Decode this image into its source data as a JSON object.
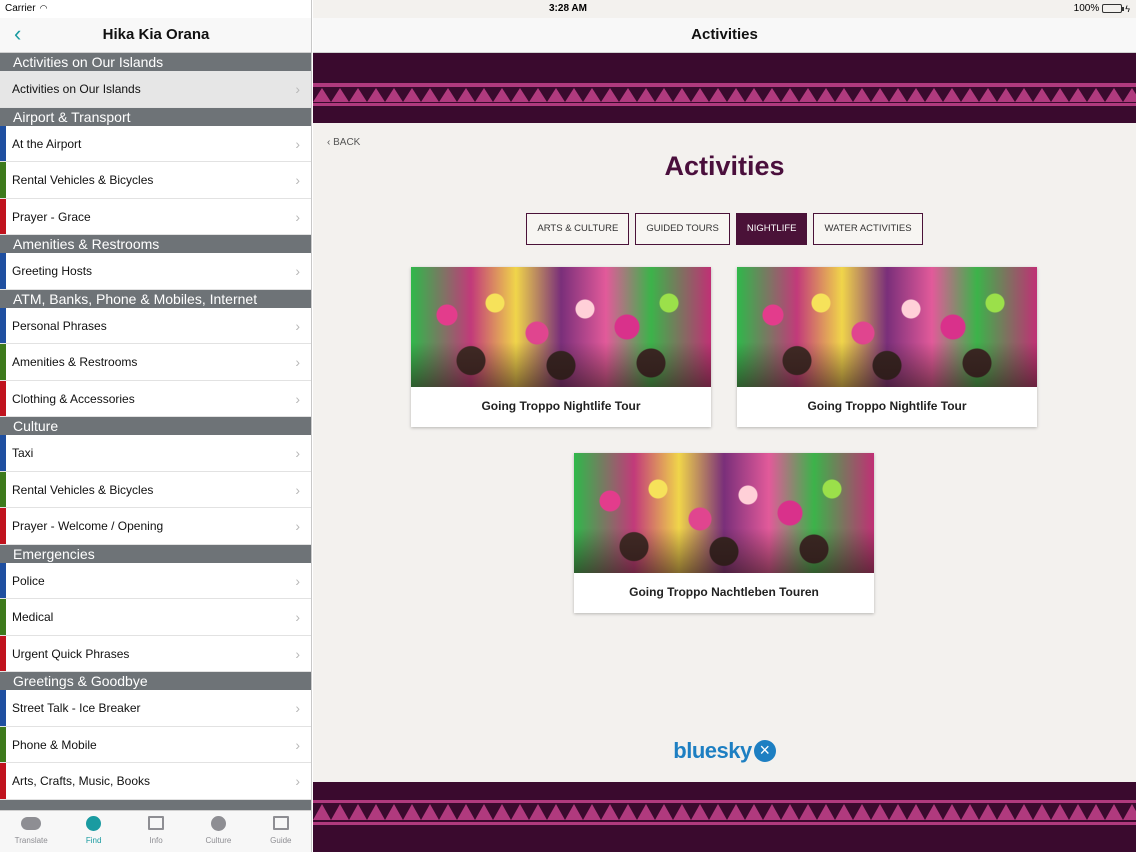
{
  "status": {
    "carrier": "Carrier",
    "time": "3:28 AM",
    "battery": "100%"
  },
  "left": {
    "title": "Hika Kia Orana",
    "sections": [
      {
        "header": "Activities on Our Islands",
        "items": [
          {
            "label": "Activities on Our Islands",
            "color": "",
            "selected": true
          }
        ]
      },
      {
        "header": "Airport & Transport",
        "items": [
          {
            "label": "At the Airport",
            "color": "#1f4fa0"
          },
          {
            "label": "Rental Vehicles & Bicycles",
            "color": "#3d7a1c"
          },
          {
            "label": "Prayer - Grace",
            "color": "#c0131e"
          }
        ]
      },
      {
        "header": "Amenities & Restrooms",
        "items": [
          {
            "label": "Greeting Hosts",
            "color": "#1f4fa0"
          }
        ]
      },
      {
        "header": "ATM, Banks, Phone & Mobiles, Internet",
        "items": [
          {
            "label": "Personal Phrases",
            "color": "#1f4fa0"
          },
          {
            "label": "Amenities & Restrooms",
            "color": "#3d7a1c"
          },
          {
            "label": "Clothing & Accessories",
            "color": "#c0131e"
          }
        ]
      },
      {
        "header": "Culture",
        "items": [
          {
            "label": "Taxi",
            "color": "#1f4fa0"
          },
          {
            "label": "Rental Vehicles & Bicycles",
            "color": "#3d7a1c"
          },
          {
            "label": "Prayer - Welcome / Opening",
            "color": "#c0131e"
          }
        ]
      },
      {
        "header": "Emergencies",
        "items": [
          {
            "label": "Police",
            "color": "#1f4fa0"
          },
          {
            "label": "Medical",
            "color": "#3d7a1c"
          },
          {
            "label": "Urgent Quick Phrases",
            "color": "#c0131e"
          }
        ]
      },
      {
        "header": "Greetings & Goodbye",
        "items": [
          {
            "label": "Street Talk - Ice Breaker",
            "color": "#1f4fa0"
          },
          {
            "label": "Phone & Mobile",
            "color": "#3d7a1c"
          },
          {
            "label": "Arts, Crafts, Music, Books",
            "color": "#c0131e"
          }
        ]
      },
      {
        "header": "",
        "items": []
      }
    ]
  },
  "tabs": [
    {
      "label": "Translate",
      "icon": "speech-bubble-icon",
      "active": false
    },
    {
      "label": "Find",
      "icon": "globe-icon",
      "active": true
    },
    {
      "label": "Info",
      "icon": "book-icon",
      "active": false
    },
    {
      "label": "Culture",
      "icon": "globe-icon",
      "active": false
    },
    {
      "label": "Guide",
      "icon": "guide-book-icon",
      "active": false
    }
  ],
  "right": {
    "title": "Activities",
    "back_label": "BACK",
    "heading": "Activities",
    "filters": [
      {
        "label": "ARTS & CULTURE",
        "active": false
      },
      {
        "label": "GUIDED TOURS",
        "active": false
      },
      {
        "label": "NIGHTLIFE",
        "active": true
      },
      {
        "label": "WATER ACTIVITIES",
        "active": false
      }
    ],
    "cards": [
      {
        "title": "Going Troppo Nightlife Tour"
      },
      {
        "title": "Going Troppo Nightlife Tour"
      },
      {
        "title": "Going Troppo Nachtleben Touren"
      }
    ],
    "logo_text": "bluesky"
  },
  "colors": {
    "accent": "#1a9ba1",
    "brand_dark": "#4a1238",
    "band": "#3a0a2e",
    "pattern": "#b03a7e"
  }
}
